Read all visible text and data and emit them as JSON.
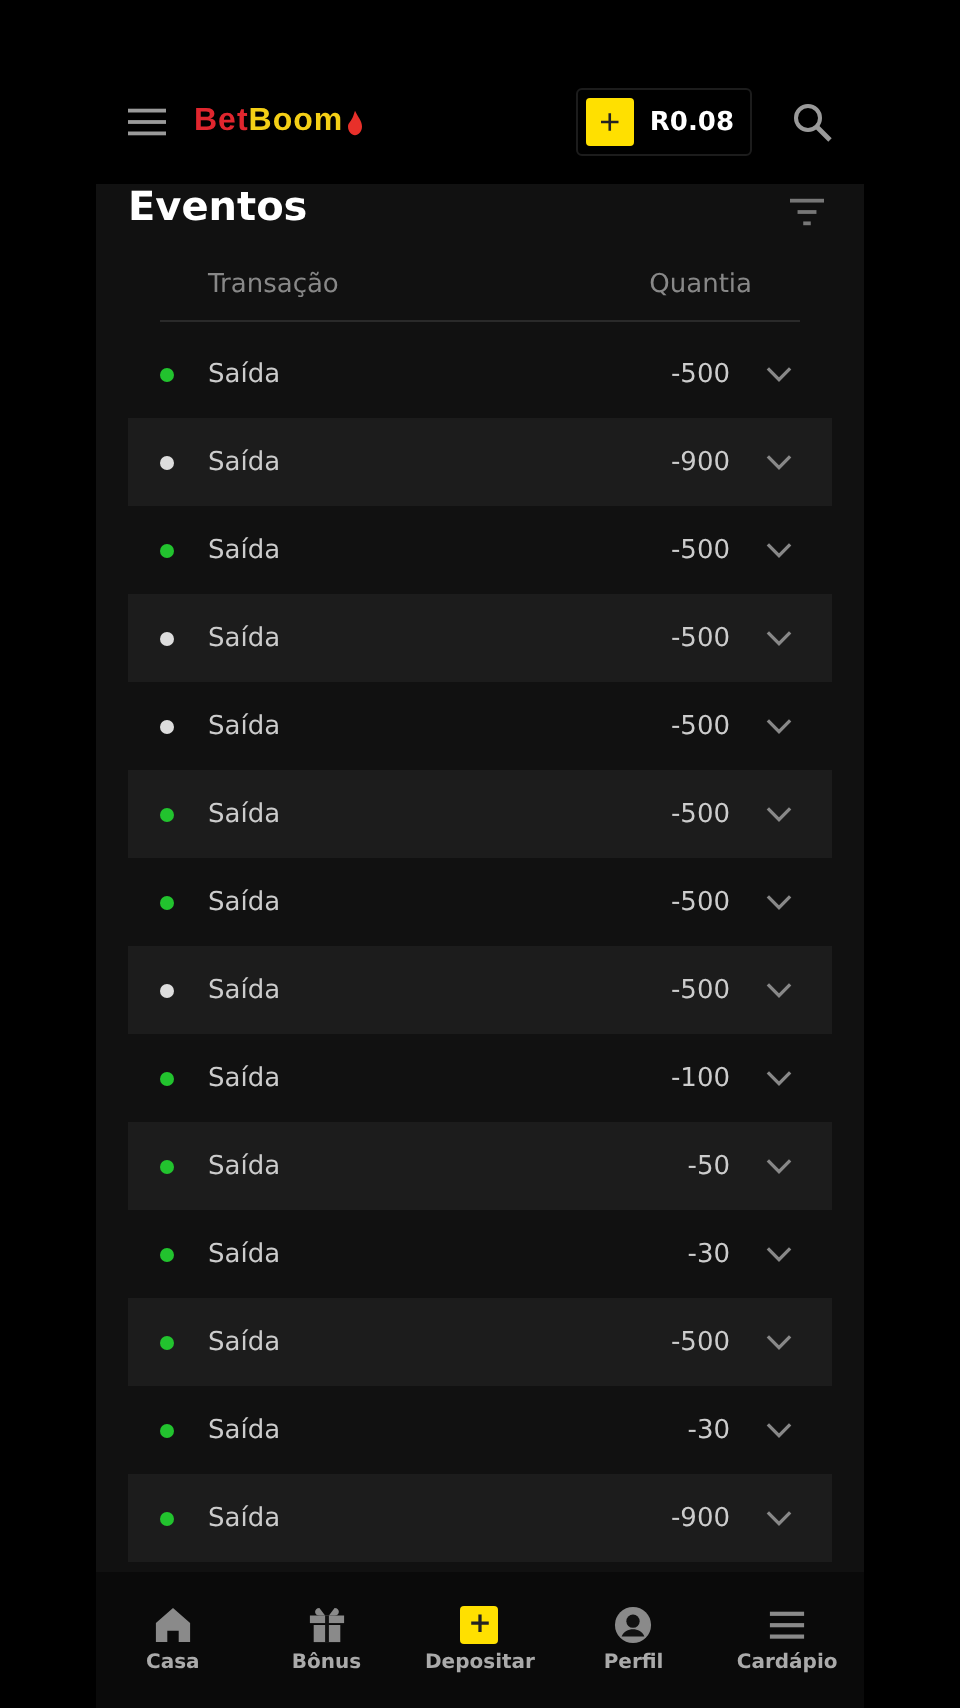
{
  "header": {
    "logo_part1": "Bet",
    "logo_part2": "Boom",
    "deposit_symbol": "+",
    "balance": "R0.08"
  },
  "section": {
    "title": "Eventos"
  },
  "table": {
    "columns": [
      "Transação",
      "Quantia"
    ],
    "rows": [
      {
        "type": "Saída",
        "amount": "-500",
        "color": "#22c32e"
      },
      {
        "type": "Saída",
        "amount": "-900",
        "color": "#dddddd"
      },
      {
        "type": "Saída",
        "amount": "-500",
        "color": "#22c32e"
      },
      {
        "type": "Saída",
        "amount": "-500",
        "color": "#dddddd"
      },
      {
        "type": "Saída",
        "amount": "-500",
        "color": "#dddddd"
      },
      {
        "type": "Saída",
        "amount": "-500",
        "color": "#22c32e"
      },
      {
        "type": "Saída",
        "amount": "-500",
        "color": "#22c32e"
      },
      {
        "type": "Saída",
        "amount": "-500",
        "color": "#dddddd"
      },
      {
        "type": "Saída",
        "amount": "-100",
        "color": "#22c32e"
      },
      {
        "type": "Saída",
        "amount": "-50",
        "color": "#22c32e"
      },
      {
        "type": "Saída",
        "amount": "-30",
        "color": "#22c32e"
      },
      {
        "type": "Saída",
        "amount": "-500",
        "color": "#22c32e"
      },
      {
        "type": "Saída",
        "amount": "-30",
        "color": "#22c32e"
      },
      {
        "type": "Saída",
        "amount": "-900",
        "color": "#22c32e"
      }
    ]
  },
  "bottom_nav": [
    {
      "kind": "home",
      "label": "Casa"
    },
    {
      "kind": "gift",
      "label": "Bônus"
    },
    {
      "kind": "deposit",
      "label": "Depositar",
      "plus": "+"
    },
    {
      "kind": "profile",
      "label": "Perfil"
    },
    {
      "kind": "menu",
      "label": "Cardápio"
    }
  ]
}
